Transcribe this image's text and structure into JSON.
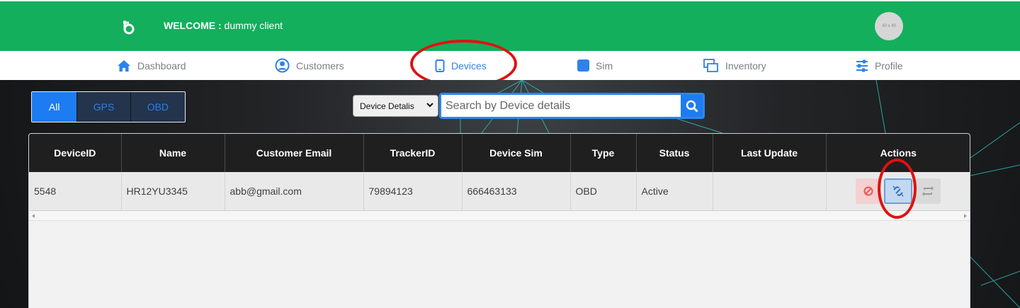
{
  "header": {
    "welcome_label": "WELCOME :",
    "welcome_user": "dummy client",
    "avatar_text": "40 x 40",
    "brand_color": "#13af5c"
  },
  "nav": {
    "items": [
      {
        "label": "Dashboard",
        "icon": "home-icon"
      },
      {
        "label": "Customers",
        "icon": "user-circle-icon"
      },
      {
        "label": "Devices",
        "icon": "tablet-icon",
        "active": true
      },
      {
        "label": "Sim",
        "icon": "sim-icon"
      },
      {
        "label": "Inventory",
        "icon": "inventory-icon"
      },
      {
        "label": "Profile",
        "icon": "sliders-icon"
      }
    ]
  },
  "filters": {
    "tabs": [
      {
        "label": "All",
        "active": true
      },
      {
        "label": "GPS"
      },
      {
        "label": "OBD"
      }
    ]
  },
  "search": {
    "select_value": "Device Detalis",
    "placeholder": "Search by Device details"
  },
  "table": {
    "columns": [
      "DeviceID",
      "Name",
      "Customer Email",
      "TrackerID",
      "Device Sim",
      "Type",
      "Status",
      "Last Update",
      "Actions"
    ],
    "rows": [
      [
        "5548",
        "HR12YU3345",
        "abb@gmail.com",
        "79894123",
        "666463133",
        "OBD",
        "Active",
        ""
      ]
    ],
    "actions": [
      "ban-icon",
      "unlink-icon",
      "swap-icon"
    ]
  },
  "accent_color": "#1d7cf2",
  "annotation_color": "#e11111"
}
